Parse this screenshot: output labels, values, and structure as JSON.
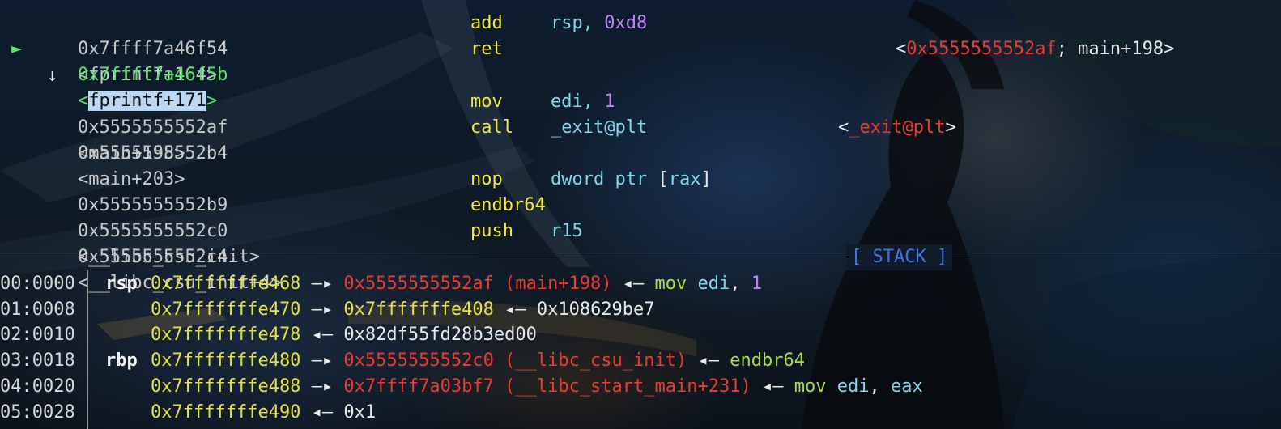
{
  "disasm": [
    {
      "address": "0x7ffff7a46f54",
      "symbol": "<fprintf+164>",
      "mnemonic": "add",
      "operands": [
        {
          "t": "rsp, ",
          "c": "op"
        },
        {
          "t": "0xd8",
          "c": "num"
        }
      ],
      "comment": []
    },
    {
      "address": "0x7ffff7a46f5b",
      "symbol_open": "<",
      "symbol_mid": "fprintf+171",
      "symbol_close": ">",
      "mnemonic": "ret",
      "operands": [],
      "current": true,
      "marker": "►",
      "comment": [
        {
          "t": "<",
          "c": "white"
        },
        {
          "t": "0x5555555552af",
          "c": "red"
        },
        {
          "t": "; main+198>",
          "c": "white"
        }
      ]
    },
    {
      "arrow": "↓"
    },
    {
      "address": "0x5555555552af",
      "symbol": "<main+198>",
      "mnemonic": "mov",
      "operands": [
        {
          "t": "edi, ",
          "c": "op"
        },
        {
          "t": "1",
          "c": "num"
        }
      ],
      "comment": []
    },
    {
      "address": "0x5555555552b4",
      "symbol": "<main+203>",
      "mnemonic": "call",
      "operands": [
        {
          "t": "_exit@plt",
          "c": "op"
        }
      ],
      "comment": [
        {
          "t": "<",
          "c": "white"
        },
        {
          "t": "_exit@plt",
          "c": "red"
        },
        {
          "t": ">",
          "c": "white"
        }
      ]
    },
    {
      "blank": true
    },
    {
      "address": "0x5555555552b9",
      "symbol": "",
      "mnemonic": "nop",
      "operands": [
        {
          "t": "dword ptr ",
          "c": "op"
        },
        {
          "t": "[",
          "c": "white"
        },
        {
          "t": "rax",
          "c": "op"
        },
        {
          "t": "]",
          "c": "white"
        }
      ],
      "comment": []
    },
    {
      "address": "0x5555555552c0",
      "symbol": "<__libc_csu_init>",
      "mnemonic": "endbr64",
      "operands": [],
      "comment": []
    },
    {
      "address": "0x5555555552c4",
      "symbol": "<__libc_csu_init+4>",
      "mnemonic": "push",
      "operands": [
        {
          "t": "r15",
          "c": "op"
        }
      ],
      "comment": []
    }
  ],
  "stack_header": "[ STACK ]",
  "stack": [
    {
      "offset": "00:0000",
      "reg": "rsp",
      "chain": [
        {
          "t": "0x7fffffffe468",
          "c": "ptr"
        },
        {
          "t": " —▸ ",
          "c": "white"
        },
        {
          "t": "0x5555555552af (main+198)",
          "c": "red"
        },
        {
          "t": " ◂— ",
          "c": "white"
        },
        {
          "t": "mov ",
          "c": "green"
        },
        {
          "t": "edi",
          "c": "op"
        },
        {
          "t": ", ",
          "c": "white"
        },
        {
          "t": "1",
          "c": "num"
        }
      ]
    },
    {
      "offset": "01:0008",
      "reg": "",
      "chain": [
        {
          "t": "0x7fffffffe470",
          "c": "ptr"
        },
        {
          "t": " —▸ ",
          "c": "white"
        },
        {
          "t": "0x7fffffffe408",
          "c": "ptr"
        },
        {
          "t": " ◂— ",
          "c": "white"
        },
        {
          "t": "0x108629be7",
          "c": "white"
        }
      ]
    },
    {
      "offset": "02:0010",
      "reg": "",
      "chain": [
        {
          "t": "0x7fffffffe478",
          "c": "ptr"
        },
        {
          "t": " ◂— ",
          "c": "white"
        },
        {
          "t": "0x82df55fd28b3ed00",
          "c": "white"
        }
      ]
    },
    {
      "offset": "03:0018",
      "reg": "rbp",
      "chain": [
        {
          "t": "0x7fffffffe480",
          "c": "ptr"
        },
        {
          "t": " —▸ ",
          "c": "white"
        },
        {
          "t": "0x5555555552c0 (__libc_csu_init)",
          "c": "red"
        },
        {
          "t": " ◂— ",
          "c": "white"
        },
        {
          "t": "endbr64",
          "c": "green"
        }
      ]
    },
    {
      "offset": "04:0020",
      "reg": "",
      "chain": [
        {
          "t": "0x7fffffffe488",
          "c": "ptr"
        },
        {
          "t": " —▸ ",
          "c": "white"
        },
        {
          "t": "0x7ffff7a03bf7 (__libc_start_main+231)",
          "c": "red"
        },
        {
          "t": " ◂— ",
          "c": "white"
        },
        {
          "t": "mov ",
          "c": "green"
        },
        {
          "t": "edi",
          "c": "op"
        },
        {
          "t": ", ",
          "c": "white"
        },
        {
          "t": "eax",
          "c": "op"
        }
      ]
    },
    {
      "offset": "05:0028",
      "reg": "",
      "chain": [
        {
          "t": "0x7fffffffe490",
          "c": "ptr"
        },
        {
          "t": " ◂— ",
          "c": "white"
        },
        {
          "t": "0x1",
          "c": "white"
        }
      ]
    }
  ]
}
